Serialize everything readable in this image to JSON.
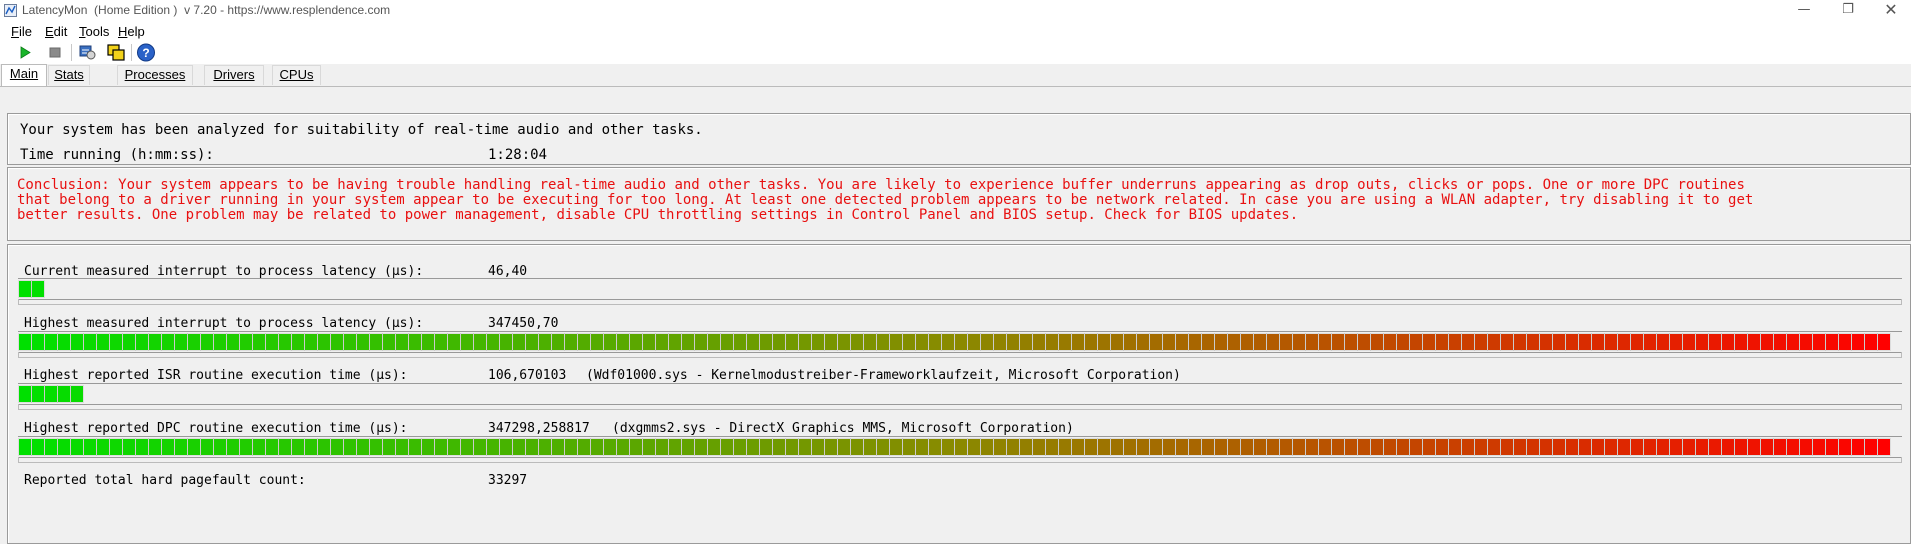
{
  "window": {
    "title": "LatencyMon  (Home Edition )  v 7.20 - https://www.resplendence.com",
    "controls": [
      "minimize",
      "restore",
      "close"
    ]
  },
  "menu": [
    {
      "label": "File",
      "accel": "F",
      "rest": "ile"
    },
    {
      "label": "Edit",
      "accel": "E",
      "rest": "dit"
    },
    {
      "label": "Tools",
      "accel": "T",
      "rest": "ools"
    },
    {
      "label": "Help",
      "accel": "H",
      "rest": "elp"
    }
  ],
  "toolbar": {
    "buttons": [
      "play-icon",
      "stop-icon",
      "settings-icon",
      "windows-icon",
      "help-icon"
    ]
  },
  "tabs": [
    {
      "label": "Main",
      "active": true
    },
    {
      "label": "Stats",
      "active": false
    },
    {
      "label": "Processes",
      "active": false
    },
    {
      "label": "Drivers",
      "active": false
    },
    {
      "label": "CPUs",
      "active": false
    }
  ],
  "summary": {
    "line1": "Your system has been analyzed for suitability of real-time audio and other tasks.",
    "time_label": "Time running (h:mm:ss):",
    "time_value": "1:28:04"
  },
  "conclusion": {
    "line1": "Conclusion: Your system appears to be having trouble handling real-time audio and other tasks. You are likely to experience buffer underruns appearing as drop outs, clicks or pops. One or more DPC routines",
    "line2": "that belong to a driver running in your system appear to be executing for too long. At least one detected problem appears to be network related. In case you are using a WLAN adapter, try disabling it to get",
    "line3": "better results. One problem may be related to power management, disable CPU throttling settings in Control Panel and BIOS setup. Check for BIOS updates."
  },
  "metrics": [
    {
      "label": "Current measured interrupt to process latency (µs):",
      "value": "46,40",
      "detail": "",
      "fill": 0.017
    },
    {
      "label": "Highest measured interrupt to process latency (µs):",
      "value": "347450,70",
      "detail": "",
      "fill": 1.0
    },
    {
      "label": "Highest reported ISR routine execution time (µs):",
      "value": "106,670103",
      "detail": "(Wdf01000.sys - Kernelmodustreiber-Frameworklaufzeit, Microsoft Corporation)",
      "fill": 0.034
    },
    {
      "label": "Highest reported DPC routine execution time (µs):",
      "value": "347298,258817",
      "detail": "(dxgmms2.sys - DirectX Graphics MMS, Microsoft Corporation)",
      "fill": 1.0
    },
    {
      "label": "Reported total hard pagefault count:",
      "value": "33297",
      "detail": ""
    }
  ],
  "colors": {
    "good": "#00e000",
    "mid": "#8a8a00",
    "bad": "#ff0000",
    "conclusion": "#e81010"
  }
}
